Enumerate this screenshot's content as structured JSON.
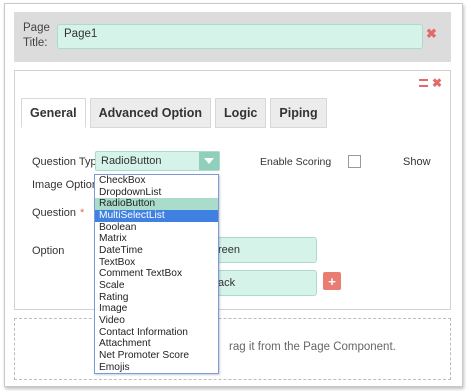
{
  "page": {
    "title_label": "Page Title:",
    "title_value": "Page1"
  },
  "panel": {
    "tabs": [
      {
        "label": "General",
        "active": true
      },
      {
        "label": "Advanced Option",
        "active": false
      },
      {
        "label": "Logic",
        "active": false
      },
      {
        "label": "Piping",
        "active": false
      }
    ],
    "question_type_label": "Question Type",
    "question_type_value": "RadioButton",
    "enable_scoring_label": "Enable Scoring",
    "show_label": "Show",
    "image_option_label": "Image Option?",
    "question_label": "Question",
    "required_mark": "*",
    "option_label": "Option",
    "option_1_partial": "reen",
    "option_2_partial": "ack",
    "plus_label": "+"
  },
  "dropdown": {
    "selected": "RadioButton",
    "hovered": "MultiSelectList",
    "options": [
      "CheckBox",
      "DropdownList",
      "RadioButton",
      "MultiSelectList",
      "Boolean",
      "Matrix",
      "DateTime",
      "TextBox",
      "Comment TextBox",
      "Scale",
      "Rating",
      "Image",
      "Video",
      "Contact Information",
      "Attachment",
      "Net Promoter Score",
      "Emojis"
    ]
  },
  "dropzone": {
    "text_partial": "rag it from the Page Component."
  },
  "colors": {
    "input_bg": "#d6f3ea",
    "accent_red": "#e36a6a",
    "hover_blue": "#3f80e0"
  }
}
